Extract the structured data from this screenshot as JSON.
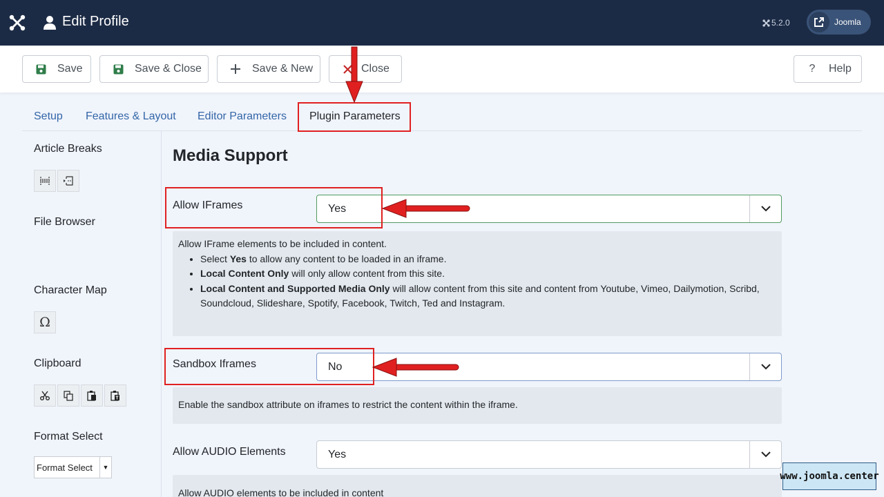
{
  "header": {
    "title": "Edit Profile",
    "version": "5.2.0",
    "site_button_label": "Joomla"
  },
  "toolbar": {
    "save": "Save",
    "save_close": "Save & Close",
    "save_new": "Save & New",
    "close": "Close",
    "help": "Help"
  },
  "tabs": [
    {
      "label": "Setup"
    },
    {
      "label": "Features & Layout"
    },
    {
      "label": "Editor Parameters"
    },
    {
      "label": "Plugin Parameters",
      "active": true
    }
  ],
  "sidebar": {
    "article_breaks": "Article Breaks",
    "file_browser": "File Browser",
    "character_map": "Character Map",
    "clipboard": "Clipboard",
    "format_select_label": "Format Select",
    "format_select_value": "Format Select"
  },
  "main": {
    "section_title": "Media Support",
    "fields": [
      {
        "label": "Allow IFrames",
        "value": "Yes",
        "desc_intro": "Allow IFrame elements to be included in content.",
        "bullets": [
          {
            "bold": "Yes",
            "pre": "Select ",
            "post": " to allow any content to be loaded in an iframe."
          },
          {
            "bold": "Local Content Only",
            "pre": "",
            "post": " will only allow content from this site."
          },
          {
            "bold": "Local Content and Supported Media Only",
            "pre": "",
            "post": " will allow content from this site and content from Youtube, Vimeo, Dailymotion, Scribd, Soundcloud, Slideshare, Spotify, Facebook, Twitch, Ted and Instagram."
          }
        ]
      },
      {
        "label": "Sandbox Iframes",
        "value": "No",
        "desc": "Enable the sandbox attribute on iframes to restrict the content within the iframe."
      },
      {
        "label": "Allow AUDIO Elements",
        "value": "Yes",
        "desc": "Allow AUDIO elements to be included in content"
      }
    ]
  },
  "watermark": "www.joomla.center",
  "colors": {
    "header_bg": "#1c2b45",
    "link": "#3366a8",
    "annotation": "#e02020",
    "save_icon": "#2f7d4a",
    "close_icon": "#c52827"
  }
}
